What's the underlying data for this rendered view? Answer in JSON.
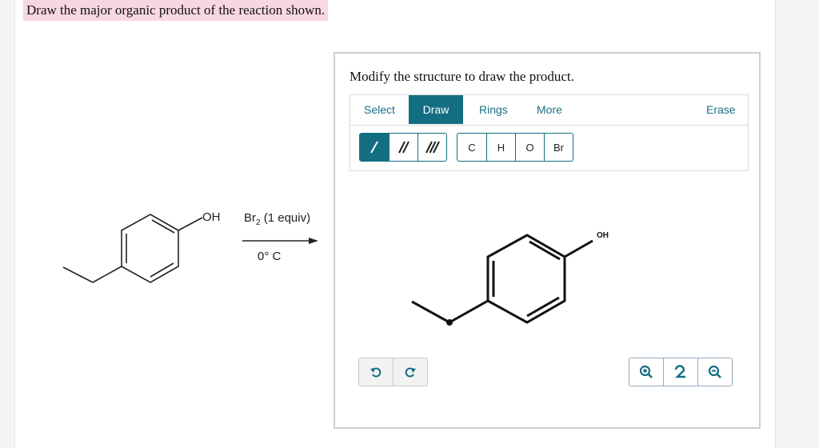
{
  "question": {
    "text": "Draw the major organic product of the reaction shown."
  },
  "reaction": {
    "substituent_label": "OH",
    "reagent": "Br",
    "reagent_subscript": "2",
    "reagent_suffix": " (1 equiv)",
    "condition": "0° C"
  },
  "editor": {
    "prompt": "Modify the structure to draw the product.",
    "tabs": {
      "select": "Select",
      "draw": "Draw",
      "rings": "Rings",
      "more": "More",
      "erase": "Erase"
    },
    "active_tab": "Draw",
    "bond_tools": [
      "single-bond",
      "double-bond",
      "triple-bond"
    ],
    "atoms": {
      "c": "C",
      "h": "H",
      "o": "O",
      "br": "Br"
    },
    "canvas_atom_label": "OH",
    "history_icons": [
      "undo-icon",
      "redo-icon"
    ],
    "zoom_icons": [
      "zoom-in-icon",
      "reset-zoom-icon",
      "zoom-out-icon"
    ]
  },
  "colors": {
    "accent": "#146e83",
    "highlight": "#f8d7e4"
  }
}
